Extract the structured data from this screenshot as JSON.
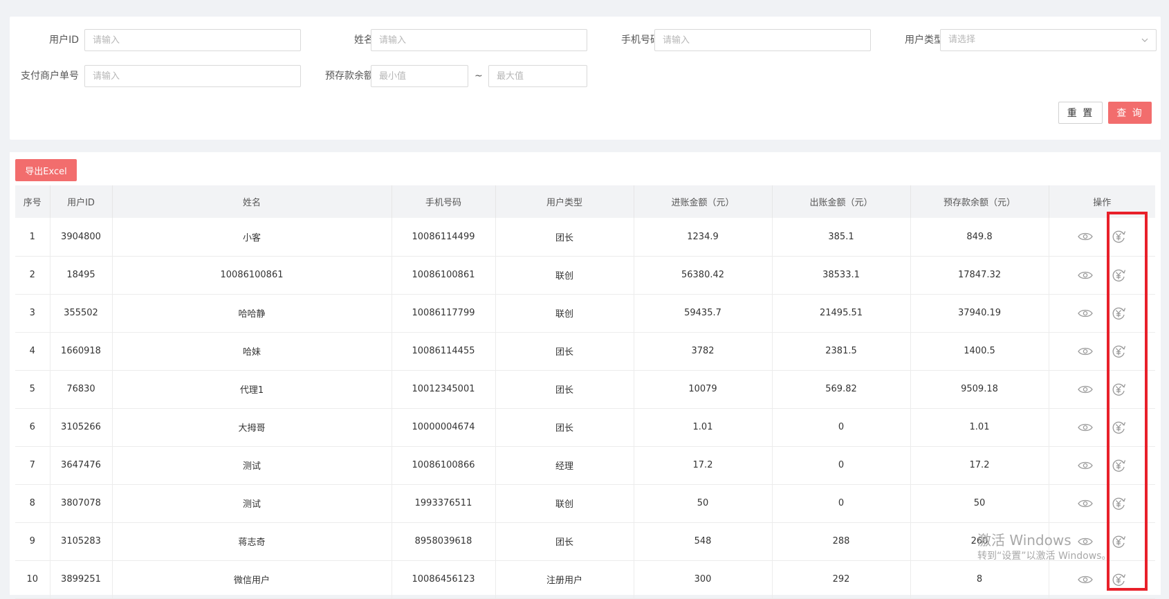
{
  "filters": {
    "user_id": {
      "label": "用户ID",
      "placeholder": "请输入"
    },
    "name": {
      "label": "姓名",
      "placeholder": "请输入"
    },
    "phone": {
      "label": "手机号码",
      "placeholder": "请输入"
    },
    "user_type": {
      "label": "用户类型",
      "placeholder": "请选择"
    },
    "pay_order": {
      "label": "支付商户单号",
      "placeholder": "请输入"
    },
    "balance": {
      "label": "预存款余额",
      "min_placeholder": "最小值",
      "separator": "~",
      "max_placeholder": "最大值"
    }
  },
  "buttons": {
    "reset": "重 置",
    "query": "查 询",
    "export": "导出Excel"
  },
  "table": {
    "headers": [
      "序号",
      "用户ID",
      "姓名",
      "手机号码",
      "用户类型",
      "进账金额（元）",
      "出账金额（元）",
      "预存款余额（元）",
      "操作"
    ],
    "rows": [
      [
        "1",
        "3904800",
        "小客",
        "10086114499",
        "团长",
        "1234.9",
        "385.1",
        "849.8"
      ],
      [
        "2",
        "18495",
        "10086100861",
        "10086100861",
        "联创",
        "56380.42",
        "38533.1",
        "17847.32"
      ],
      [
        "3",
        "355502",
        "哈哈静",
        "10086117799",
        "联创",
        "59435.7",
        "21495.51",
        "37940.19"
      ],
      [
        "4",
        "1660918",
        "哈妹",
        "10086114455",
        "团长",
        "3782",
        "2381.5",
        "1400.5"
      ],
      [
        "5",
        "76830",
        "代理1",
        "10012345001",
        "团长",
        "10079",
        "569.82",
        "9509.18"
      ],
      [
        "6",
        "3105266",
        "大拇哥",
        "10000004674",
        "团长",
        "1.01",
        "0",
        "1.01"
      ],
      [
        "7",
        "3647476",
        "测试",
        "10086100866",
        "经理",
        "17.2",
        "0",
        "17.2"
      ],
      [
        "8",
        "3807078",
        "测试",
        "1993376511",
        "联创",
        "50",
        "0",
        "50"
      ],
      [
        "9",
        "3105283",
        "蒋志奇",
        "8958039618",
        "团长",
        "548",
        "288",
        "260"
      ],
      [
        "10",
        "3899251",
        "微信用户",
        "10086456123",
        "注册用户",
        "300",
        "292",
        "8"
      ]
    ]
  },
  "icons": {
    "view": "eye-icon",
    "refund": "yuan-refund-icon"
  },
  "colors": {
    "accent": "#f26d6d",
    "highlight": "#e8202a"
  },
  "watermark": {
    "line1": "激活 Windows",
    "line2": "转到“设置”以激活 Windows。"
  }
}
